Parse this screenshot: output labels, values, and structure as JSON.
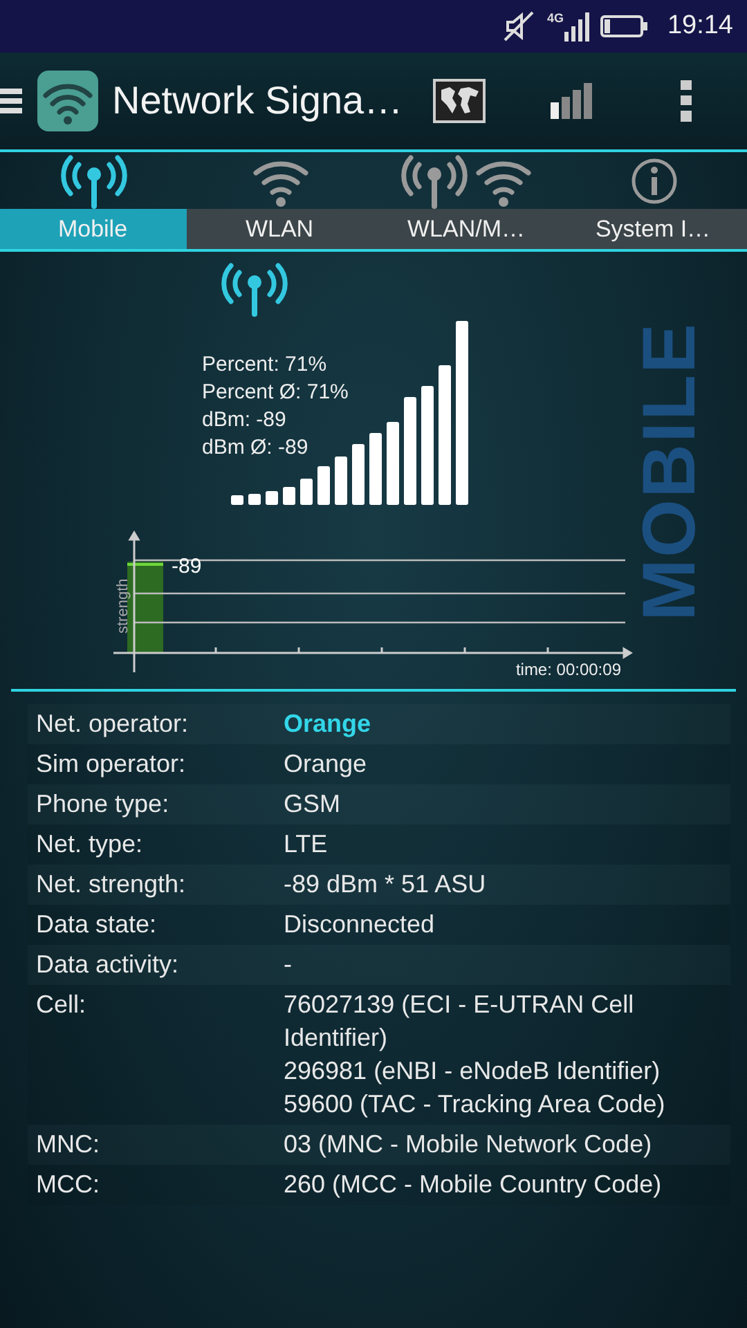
{
  "status_bar": {
    "network": "4G",
    "time": "19:14"
  },
  "app_bar": {
    "title": "Network Signa…"
  },
  "tabs": [
    {
      "kind": "mobile",
      "label": "Mobile",
      "selected": true
    },
    {
      "kind": "wlan",
      "label": "WLAN",
      "selected": false
    },
    {
      "kind": "both",
      "label": "WLAN/M…",
      "selected": false
    },
    {
      "kind": "info",
      "label": "System I…",
      "selected": false
    }
  ],
  "signal": {
    "stats": [
      "Percent: 71%",
      "Percent Ø: 71%",
      "dBm: -89",
      "dBm Ø: -89"
    ],
    "history": {
      "axis_label": "strength",
      "current": "-89",
      "time": "time: 00:00:09"
    },
    "watermark": "MOBILE"
  },
  "info": [
    {
      "label": "Net. operator:",
      "value": "Orange",
      "highlighted": true
    },
    {
      "label": "Sim operator:",
      "value": "Orange",
      "highlighted": false
    },
    {
      "label": "Phone type:",
      "value": "GSM",
      "highlighted": false
    },
    {
      "label": "Net. type:",
      "value": "LTE",
      "highlighted": false
    },
    {
      "label": "Net. strength:",
      "value": "-89 dBm * 51 ASU",
      "highlighted": false
    },
    {
      "label": "Data state:",
      "value": "Disconnected",
      "highlighted": false
    },
    {
      "label": "Data activity:",
      "value": "-",
      "highlighted": false
    },
    {
      "label": "Cell:",
      "lines": [
        "76027139 (ECI - E-UTRAN Cell Identifier)",
        "296981 (eNBI - eNodeB Identifier)",
        "59600 (TAC - Tracking Area Code)"
      ],
      "highlighted": false
    },
    {
      "label": "MNC:",
      "value": "03 (MNC - Mobile Network Code)",
      "highlighted": false
    },
    {
      "label": "MCC:",
      "value": "260 (MCC - Mobile Country Code)",
      "highlighted": false
    }
  ]
}
